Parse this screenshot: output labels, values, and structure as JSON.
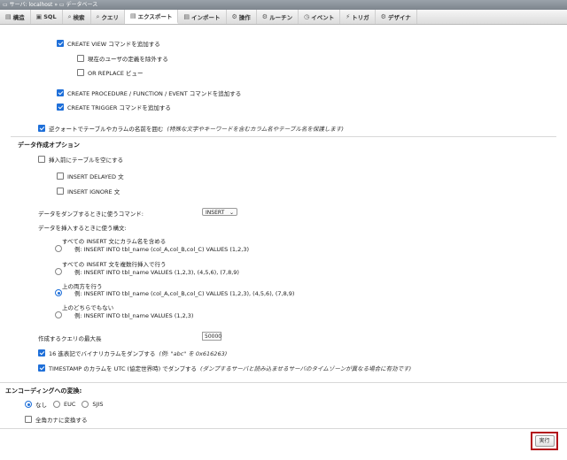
{
  "breadcrumb": {
    "server": "サーバ: localhost",
    "database": "データベース"
  },
  "tabs": [
    {
      "label": "構造",
      "icon": "▤"
    },
    {
      "label": "SQL",
      "icon": "▣"
    },
    {
      "label": "検索",
      "icon": "⌕"
    },
    {
      "label": "クエリ",
      "icon": "⌕"
    },
    {
      "label": "エクスポート",
      "icon": "▤"
    },
    {
      "label": "インポート",
      "icon": "▤"
    },
    {
      "label": "操作",
      "icon": "⚙"
    },
    {
      "label": "ルーチン",
      "icon": "⚙"
    },
    {
      "label": "イベント",
      "icon": "◷"
    },
    {
      "label": "トリガ",
      "icon": "⚡"
    },
    {
      "label": "デザイナ",
      "icon": "⚙"
    }
  ],
  "options": {
    "create_view": "CREATE VIEW コマンドを追加する",
    "exclude_current_user": "現在のユーザの定義を除外する",
    "or_replace_view": "OR REPLACE ビュー",
    "create_procedure": "CREATE PROCEDURE / FUNCTION / EVENT コマンドを追加する",
    "create_trigger": "CREATE TRIGGER コマンドを追加する",
    "backquote": "逆クォートでテーブルやカラムの名前を囲む",
    "backquote_note": "(特殊な文字やキーワードを含むカラム名やテーブル名を保護します)"
  },
  "data_options": {
    "title": "データ作成オプション",
    "truncate": "挿入前にテーブルを空にする",
    "insert_delayed": "INSERT DELAYED 文",
    "insert_ignore": "INSERT IGNORE 文",
    "dump_command_label": "データをダンプするときに使うコマンド:",
    "dump_command_value": "INSERT",
    "syntax_label": "データを挿入するときに使う構文:",
    "syntax_options": [
      {
        "title": "すべての INSERT 文にカラム名を含める",
        "example": "例: INSERT INTO tbl_name (col_A,col_B,col_C) VALUES (1,2,3)"
      },
      {
        "title": "すべての INSERT 文を複数行挿入で行う",
        "example": "例: INSERT INTO tbl_name VALUES (1,2,3), (4,5,6), (7,8,9)"
      },
      {
        "title": "上の両方を行う",
        "example": "例: INSERT INTO tbl_name (col_A,col_B,col_C) VALUES (1,2,3), (4,5,6), (7,8,9)"
      },
      {
        "title": "上のどちらでもない",
        "example": "例: INSERT INTO tbl_name VALUES (1,2,3)"
      }
    ],
    "max_query_label": "作成するクエリの最大長",
    "max_query_value": "50000",
    "hex_dump": "16 進表記でバイナリカラムをダンプする",
    "hex_dump_note": "(例: \"abc\" を 0x616263)",
    "timestamp_utc": "TIMESTAMP のカラムを UTC (協定世界時) でダンプする",
    "timestamp_note": "(ダンプするサーバと読み込ませるサーバのタイムゾーンが異なる場合に有効です)"
  },
  "encoding": {
    "title": "エンコーディングへの変換:",
    "choices": [
      "なし",
      "EUC",
      "SJIS"
    ],
    "kana": "全角カナに変換する"
  },
  "actions": {
    "execute": "実行"
  },
  "colors": {
    "accent": "#1e6fd9",
    "highlight": "#b3121a"
  }
}
